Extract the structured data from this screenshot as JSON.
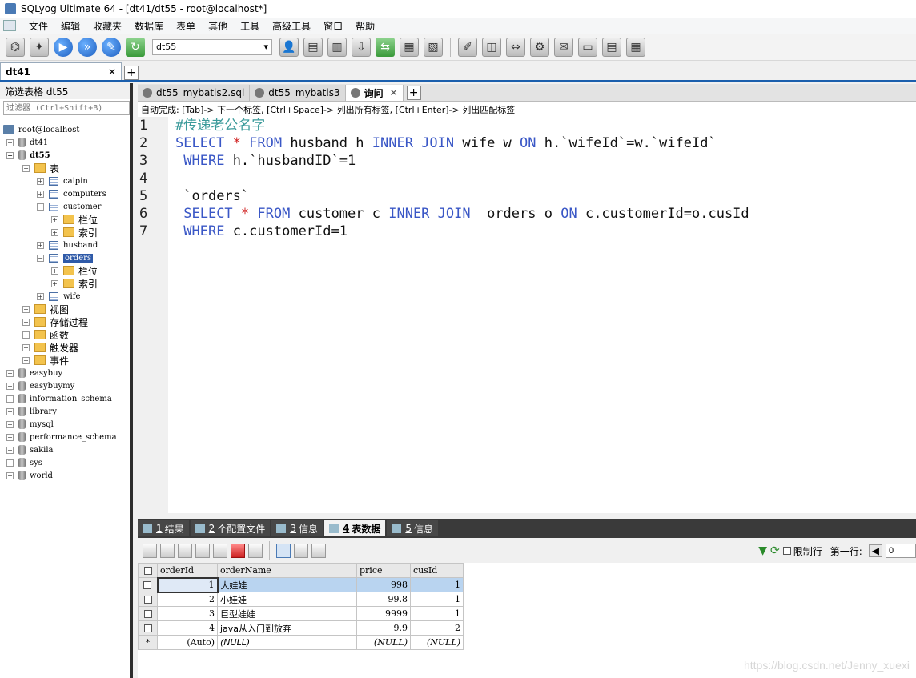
{
  "window": {
    "title": "SQLyog Ultimate 64 - [dt41/dt55 - root@localhost*]"
  },
  "menu": [
    "文件",
    "编辑",
    "收藏夹",
    "数据库",
    "表单",
    "其他",
    "工具",
    "高级工具",
    "窗口",
    "帮助"
  ],
  "toolbar": {
    "db_selector": "dt55"
  },
  "connection_tabs": [
    {
      "label": "dt41"
    }
  ],
  "sidebar": {
    "filter_label": "筛选表格 dt55",
    "filter_placeholder": "过滤器 (Ctrl+Shift+B)",
    "tree": {
      "root": "root@localhost",
      "dt41": "dt41",
      "dt55": "dt55",
      "tables_folder": "表",
      "caipin": "caipin",
      "computers": "computers",
      "customer": "customer",
      "customer_columns": "栏位",
      "customer_indexes": "索引",
      "husband": "husband",
      "orders": "orders",
      "orders_columns": "栏位",
      "orders_indexes": "索引",
      "wife": "wife",
      "views": "视图",
      "procs": "存储过程",
      "funcs": "函数",
      "triggers": "触发器",
      "events": "事件",
      "databases": [
        "easybuy",
        "easybuymy",
        "information_schema",
        "library",
        "mysql",
        "performance_schema",
        "sakila",
        "sys",
        "world"
      ]
    }
  },
  "query_tabs": [
    {
      "label": "dt55_mybatis2.sql"
    },
    {
      "label": "dt55_mybatis3"
    },
    {
      "label": "询问"
    }
  ],
  "autocomplete_hint": "自动完成: [Tab]-> 下一个标签, [Ctrl+Space]-> 列出所有标签, [Ctrl+Enter]-> 列出匹配标签",
  "editor": {
    "line_numbers": [
      "1",
      "2",
      "3",
      "4",
      "5",
      "6",
      "7"
    ],
    "line1": "#传递老公名字",
    "line2": {
      "kw1": "SELECT",
      "star": "*",
      "kw2": "FROM",
      "t1": "husband h",
      "kw3": "INNER JOIN",
      "t2": "wife w",
      "kw4": "ON",
      "t3": "h.`wifeId`=w.`wifeId`"
    },
    "line3": {
      "kw": "WHERE",
      "t": "h.`husbandID`=1"
    },
    "line5": "`orders`",
    "line6": {
      "kw1": "SELECT",
      "star": "*",
      "kw2": "FROM",
      "t1": "customer c",
      "kw3": "INNER JOIN",
      "t2": "orders o",
      "kw4": "ON",
      "t3": "c.customerId=o.cusId"
    },
    "line7": {
      "kw": "WHERE",
      "t": "c.customerId=1"
    }
  },
  "result_tabs": [
    {
      "num": "1",
      "label": "结果"
    },
    {
      "num": "2",
      "label": "个配置文件"
    },
    {
      "num": "3",
      "label": "信息"
    },
    {
      "num": "4",
      "label": "表数据"
    },
    {
      "num": "5",
      "label": "信息"
    }
  ],
  "result_toolbar": {
    "limit_label": "限制行",
    "first_row_label": "第一行:",
    "first_row_value": "0"
  },
  "grid": {
    "columns": [
      "orderId",
      "orderName",
      "price",
      "cusId"
    ],
    "rows": [
      [
        "1",
        "大娃娃",
        "998",
        "1"
      ],
      [
        "2",
        "小娃娃",
        "99.8",
        "1"
      ],
      [
        "3",
        "巨型娃娃",
        "9999",
        "1"
      ],
      [
        "4",
        "java从入门到放弃",
        "9.9",
        "2"
      ]
    ],
    "new_row": [
      "(Auto)",
      "(NULL)",
      "(NULL)",
      "(NULL)"
    ],
    "new_row_marker": "*"
  },
  "watermark": "https://blog.csdn.net/Jenny_xuexi"
}
